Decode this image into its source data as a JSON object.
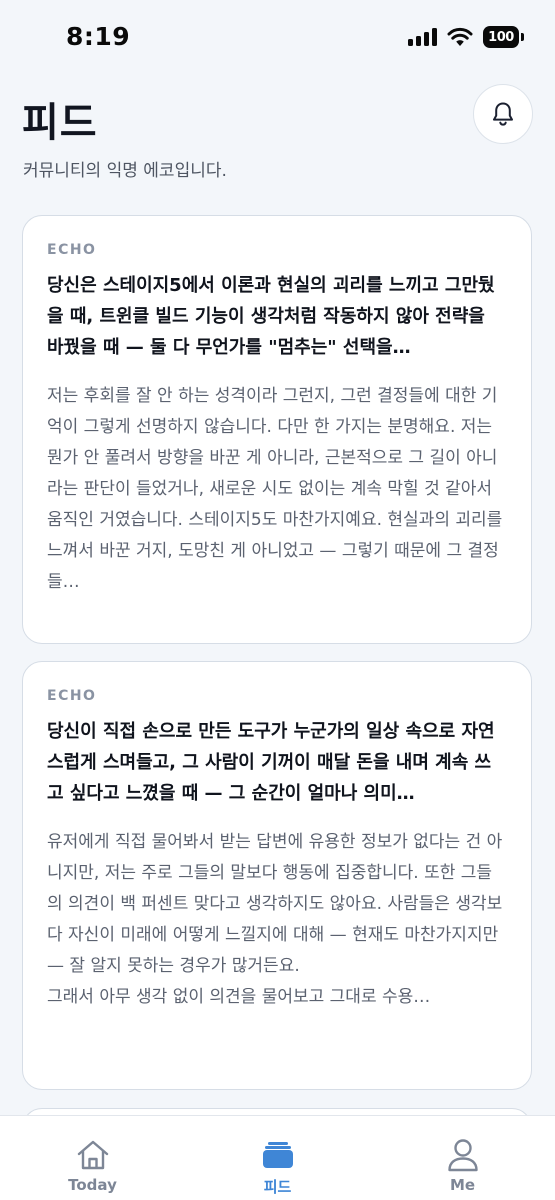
{
  "status_bar": {
    "time": "8:19",
    "battery": "100"
  },
  "header": {
    "title": "피드",
    "subtitle": "커뮤니티의 익명 에코입니다."
  },
  "cards": [
    {
      "tag": "ECHO",
      "question": "당신은 스테이지5에서 이론과 현실의 괴리를 느끼고 그만뒀을 때, 트윈클 빌드 기능이 생각처럼 작동하지 않아 전략을 바꿨을 때 — 둘 다 무언가를 \"멈추는\" 선택을…",
      "answer": "저는 후회를 잘 안 하는 성격이라 그런지, 그런 결정들에 대한 기억이 그렇게 선명하지 않습니다. 다만 한 가지는 분명해요. 저는 뭔가 안 풀려서 방향을 바꾼 게 아니라, 근본적으로 그 길이 아니라는 판단이 들었거나, 새로운 시도 없이는 계속 막힐 것 같아서 움직인 거였습니다. 스테이지5도 마찬가지예요. 현실과의 괴리를 느껴서 바꾼 거지, 도망친 게 아니었고 — 그렇기 때문에 그 결정들…"
    },
    {
      "tag": "ECHO",
      "question": "당신이 직접 손으로 만든 도구가 누군가의 일상 속으로 자연스럽게 스며들고, 그 사람이 기꺼이 매달 돈을 내며 계속 쓰고 싶다고 느꼈을 때 — 그 순간이 얼마나 의미…",
      "answer": "유저에게 직접 물어봐서 받는 답변에 유용한 정보가 없다는 건 아니지만, 저는 주로 그들의 말보다 행동에 집중합니다. 또한 그들의 의견이 백 퍼센트 맞다고 생각하지도 않아요. 사람들은 생각보다 자신이 미래에 어떻게 느낄지에 대해 — 현재도 마찬가지지만 — 잘 알지 못하는 경우가 많거든요.\n그래서 아무 생각 없이 의견을 물어보고 그대로 수용…"
    }
  ],
  "tab_bar": {
    "today": "Today",
    "feed": "피드",
    "me": "Me"
  },
  "colors": {
    "background": "#f3f6fa",
    "accent": "#3f86d6",
    "inactive": "#7d8696"
  }
}
